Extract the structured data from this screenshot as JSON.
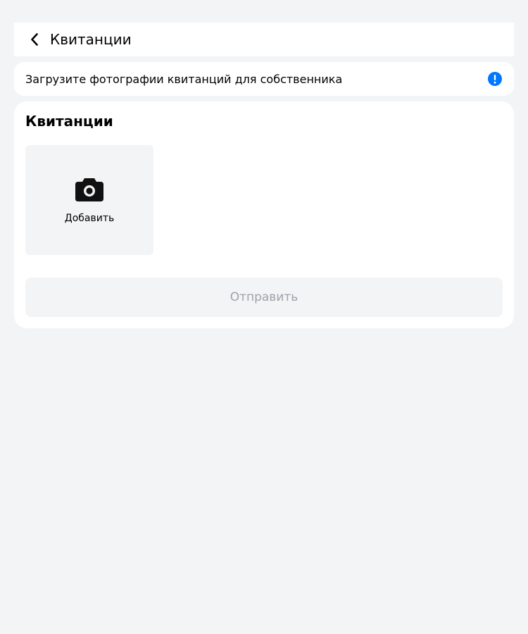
{
  "header": {
    "title": "Квитанции",
    "back_icon": "chevron-left-icon"
  },
  "notice": {
    "text": "Загрузите фотографии квитанций для собственника",
    "icon": "info-icon",
    "icon_color": "#0077ff"
  },
  "card": {
    "title": "Квитанции",
    "add_tile": {
      "icon": "camera-icon",
      "label": "Добавить"
    },
    "submit_label": "Отправить",
    "submit_disabled": true
  },
  "colors": {
    "background": "#f3f4f6",
    "surface": "#ffffff",
    "accent": "#0077ff",
    "disabled_text": "#9ea2a9"
  }
}
